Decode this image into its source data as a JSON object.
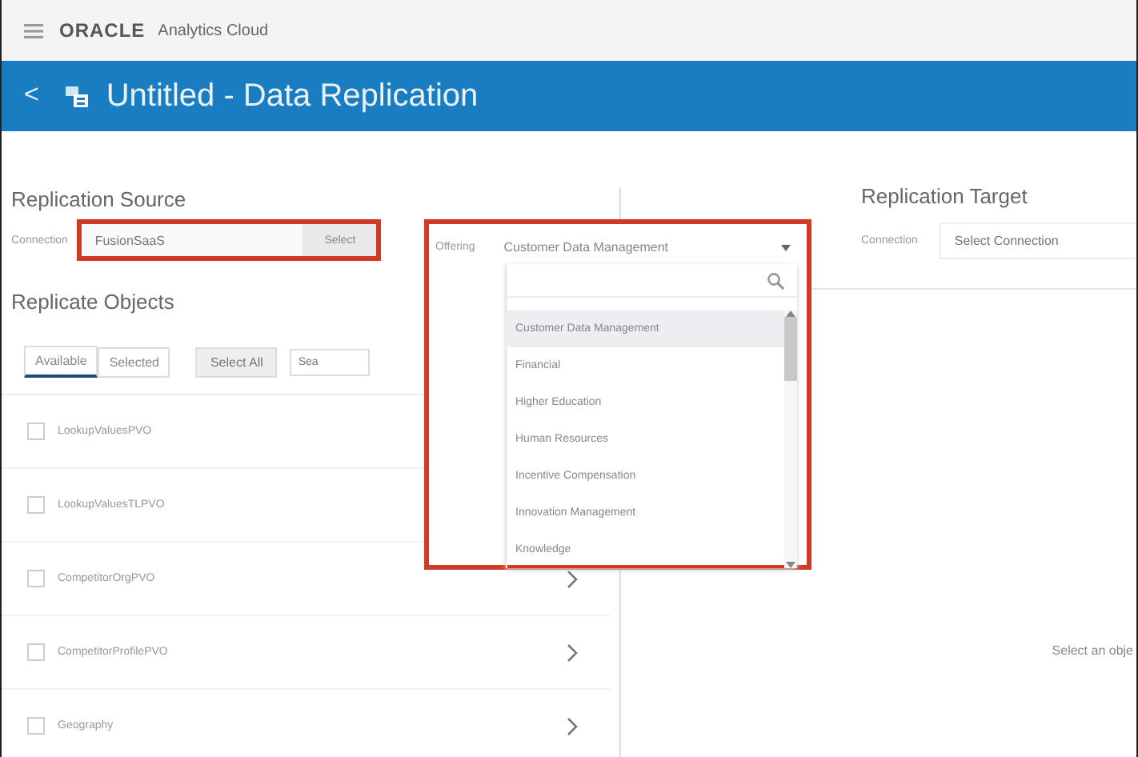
{
  "app_bar": {
    "brand": "ORACLE",
    "product": "Analytics Cloud"
  },
  "title_bar": {
    "back": "<",
    "title": "Untitled - Data Replication"
  },
  "source": {
    "heading": "Replication Source",
    "connection_label": "Connection",
    "connection_value": "FusionSaaS",
    "select_button": "Select",
    "offering_label": "Offering",
    "offering_value": "Customer Data Management"
  },
  "offering_dropdown": {
    "items": [
      {
        "label": "Customer Data Management",
        "selected": true
      },
      {
        "label": "Financial",
        "selected": false
      },
      {
        "label": "Higher Education",
        "selected": false
      },
      {
        "label": "Human Resources",
        "selected": false
      },
      {
        "label": "Incentive Compensation",
        "selected": false
      },
      {
        "label": "Innovation Management",
        "selected": false
      },
      {
        "label": "Knowledge",
        "selected": false
      }
    ]
  },
  "objects": {
    "heading": "Replicate Objects",
    "tabs": [
      {
        "label": "Available",
        "selected": true
      },
      {
        "label": "Selected",
        "selected": false
      }
    ],
    "select_all": "Select All",
    "search_placeholder": "Sea",
    "rows": [
      {
        "name": "LookupValuesPVO",
        "checked": false
      },
      {
        "name": "LookupValuesTLPVO",
        "checked": false
      },
      {
        "name": "CompetitorOrgPVO",
        "checked": false
      },
      {
        "name": "CompetitorProfilePVO",
        "checked": false
      },
      {
        "name": "Geography",
        "checked": false
      }
    ]
  },
  "target": {
    "heading": "Replication Target",
    "connection_label": "Connection",
    "connection_placeholder": "Select Connection",
    "empty_message": "Select an obje"
  }
}
